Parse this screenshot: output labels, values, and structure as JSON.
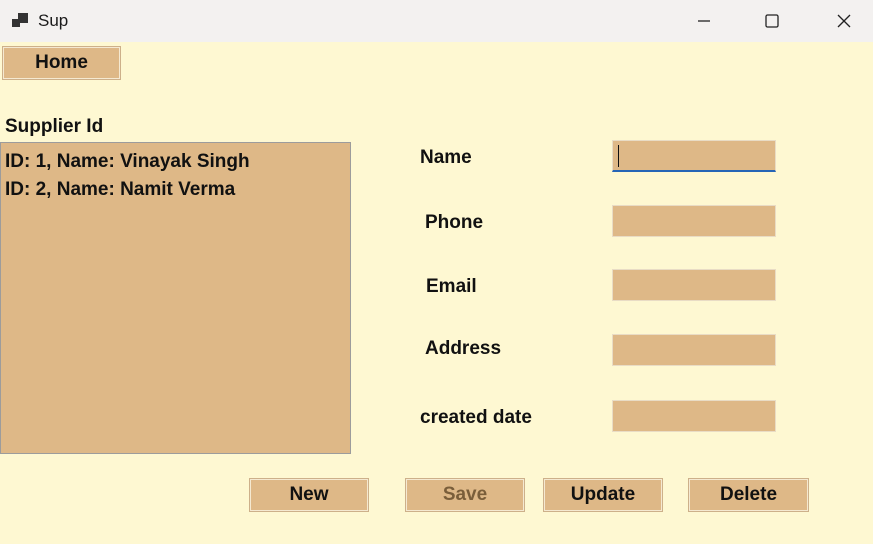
{
  "window": {
    "title": "Sup",
    "controls": [
      "minimize",
      "maximize",
      "close"
    ]
  },
  "toolbar": {
    "home_label": "Home"
  },
  "list": {
    "label": "Supplier Id",
    "items": [
      "ID: 1, Name: Vinayak Singh",
      "ID: 2, Name: Namit Verma"
    ]
  },
  "form": {
    "fields": [
      {
        "label": "Name",
        "value": ""
      },
      {
        "label": "Phone",
        "value": ""
      },
      {
        "label": "Email",
        "value": ""
      },
      {
        "label": "Address",
        "value": ""
      },
      {
        "label": "created date",
        "value": ""
      }
    ]
  },
  "actions": {
    "new_label": "New",
    "save_label": "Save",
    "update_label": "Update",
    "delete_label": "Delete"
  },
  "colors": {
    "background": "#fef8d2",
    "control": "#deb887",
    "focus": "#2565b6"
  }
}
